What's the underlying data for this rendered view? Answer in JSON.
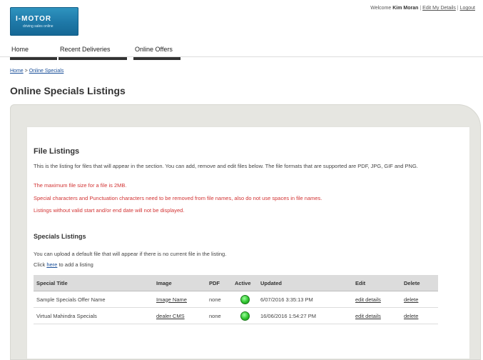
{
  "header": {
    "logo_text": "I-MOTOR",
    "logo_subtext": "driving sales online",
    "welcome_prefix": "Welcome",
    "user_name": "Kim Moran",
    "edit_details": "Edit My Details",
    "logout": "Logout",
    "separator": "|"
  },
  "nav": {
    "items": [
      {
        "label": "Home"
      },
      {
        "label": "Recent Deliveries"
      },
      {
        "label": "Online Offers"
      }
    ]
  },
  "breadcrumb": {
    "home": "Home",
    "sep": ">",
    "current": "Online Specials"
  },
  "page": {
    "title": "Online Specials Listings"
  },
  "file_listings": {
    "heading": "File Listings",
    "intro": "This is the listing for files that will appear in the section. You can add, remove and edit files below. The file formats that are supported are PDF, JPG, GIF and PNG.",
    "max_size": "The maximum file size for a file is 2MB.",
    "special_chars": "Special characters and Punctuation characters need to be removed from file names, also do not use spaces in file names.",
    "dates_note": "Listings without valid start and/or end date will not be displayed."
  },
  "specials": {
    "heading": "Specials Listings",
    "upload_note": "You can upload a default file that will appear if there is no current file in the listing.",
    "click_prefix": "Click",
    "click_link": "here",
    "click_suffix": "to add a listing",
    "columns": [
      "Special Title",
      "Image",
      "PDF",
      "Active",
      "Updated",
      "Edit",
      "Delete"
    ],
    "rows": [
      {
        "title": "Sample Specials Offer Name",
        "image": "Image Name",
        "pdf": "none",
        "active": true,
        "updated": "6/07/2016 3:35:13 PM",
        "edit": "edit details",
        "delete": "delete"
      },
      {
        "title": "Virtual Mahindra Specials",
        "image": "dealer CMS",
        "pdf": "none",
        "active": true,
        "updated": "16/06/2016 1:54:27 PM",
        "edit": "edit details",
        "delete": "delete"
      }
    ]
  },
  "colors": {
    "warning": "#d23333",
    "link": "#1a4f99",
    "active": "#2fc52f",
    "brand": "#1e78a7"
  }
}
